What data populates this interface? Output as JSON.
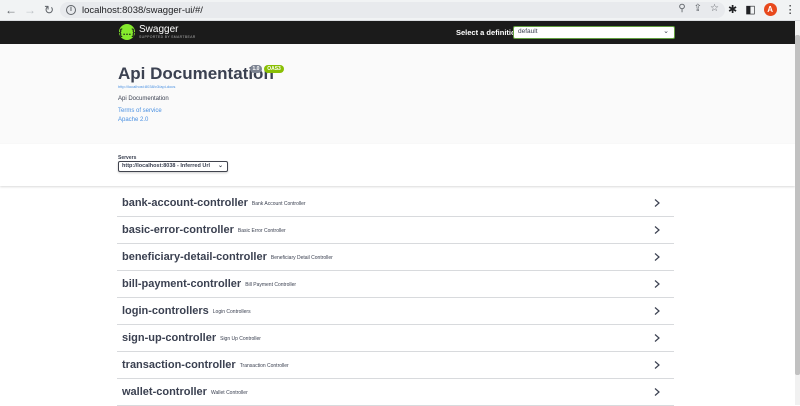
{
  "browser": {
    "url": "localhost:8038/swagger-ui/#/",
    "avatar_letter": "A"
  },
  "topbar": {
    "logo_name": "Swagger",
    "logo_sub": "SUPPORTED BY SMARTBEAR",
    "definition_label": "Select a definition",
    "definition_value": "default"
  },
  "info": {
    "title": "Api Documentation",
    "version_badge": "1.0",
    "oas_badge": "OAS3",
    "url": "http://localhost:8038/v3/api-docs",
    "description": "Api Documentation",
    "terms_link": "Terms of service",
    "license_link": "Apache 2.0"
  },
  "servers": {
    "label": "Servers",
    "selected": "http://localhost:8038 - Inferred Url"
  },
  "tags": [
    {
      "name": "bank-account-controller",
      "desc": "Bank Account Controller"
    },
    {
      "name": "basic-error-controller",
      "desc": "Basic Error Controller"
    },
    {
      "name": "beneficiary-detail-controller",
      "desc": "Beneficiary Detail Controller"
    },
    {
      "name": "bill-payment-controller",
      "desc": "Bill Payment Controller"
    },
    {
      "name": "login-controllers",
      "desc": "Login Controllers"
    },
    {
      "name": "sign-up-controller",
      "desc": "Sign Up Controller"
    },
    {
      "name": "transaction-controller",
      "desc": "Transaction Controller"
    },
    {
      "name": "wallet-controller",
      "desc": "Wallet Controller"
    }
  ],
  "colors": {
    "topbar_bg": "#1b1b1b",
    "swagger_green": "#85ea2d",
    "text": "#3b4151",
    "link": "#4990e2"
  }
}
